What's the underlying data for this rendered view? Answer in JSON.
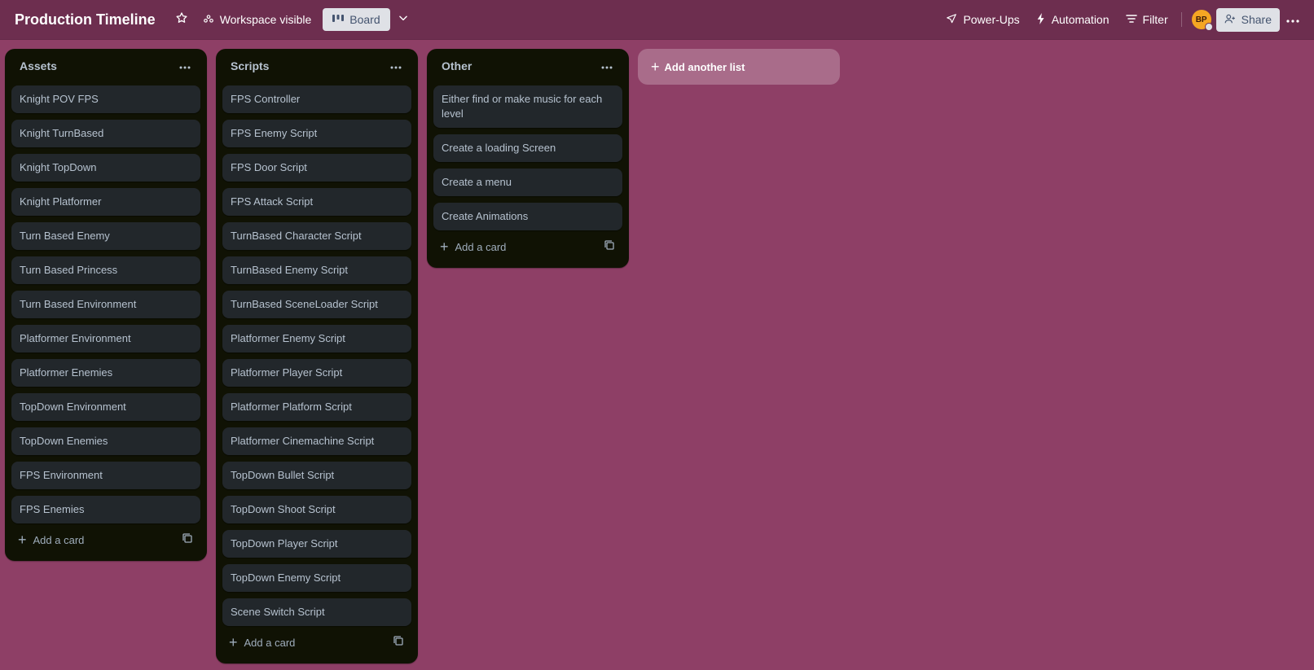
{
  "header": {
    "title": "Production Timeline",
    "workspace_label": "Workspace visible",
    "view_label": "Board",
    "powerups_label": "Power-Ups",
    "automation_label": "Automation",
    "filter_label": "Filter",
    "avatar_initials": "BP",
    "share_label": "Share"
  },
  "lists": [
    {
      "title": "Assets",
      "add_card_label": "Add a card",
      "cards": [
        "Knight POV FPS",
        "Knight TurnBased",
        "Knight TopDown",
        "Knight Platformer",
        "Turn Based Enemy",
        "Turn Based Princess",
        "Turn Based Environment",
        "Platformer Environment",
        "Platformer Enemies",
        "TopDown Environment",
        "TopDown Enemies",
        "FPS Environment",
        "FPS Enemies"
      ]
    },
    {
      "title": "Scripts",
      "add_card_label": "Add a card",
      "cards": [
        "FPS Controller",
        "FPS Enemy Script",
        "FPS Door Script",
        "FPS Attack Script",
        "TurnBased Character Script",
        "TurnBased Enemy Script",
        "TurnBased SceneLoader Script",
        "Platformer Enemy Script",
        "Platformer Player Script",
        "Platformer Platform Script",
        "Platformer Cinemachine Script",
        "TopDown Bullet Script",
        "TopDown Shoot Script",
        "TopDown Player Script",
        "TopDown Enemy Script",
        "Scene Switch Script"
      ]
    },
    {
      "title": "Other",
      "add_card_label": "Add a card",
      "cards": [
        "Either find or make music for each level",
        "Create a loading Screen",
        "Create a menu",
        "Create Animations"
      ]
    }
  ],
  "add_list_label": "Add another list",
  "colors": {
    "board_background": "#8e3f66",
    "header_background": "#6d2e4f",
    "list_background": "#101204",
    "card_background": "#22272b"
  }
}
